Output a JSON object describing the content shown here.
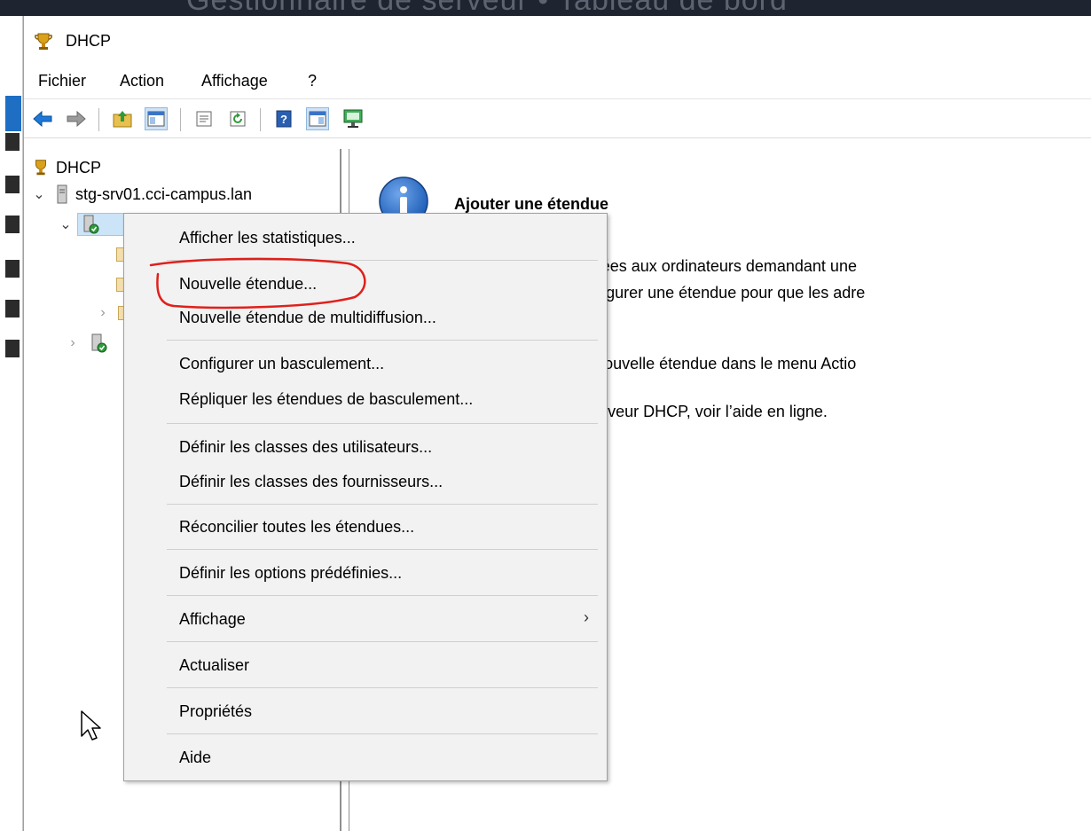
{
  "background": {
    "top_title": "Gestionnaire de serveur • Tableau de bord"
  },
  "window": {
    "title": "DHCP",
    "menu": [
      "Fichier",
      "Action",
      "Affichage",
      "?"
    ]
  },
  "toolbar": {
    "icons": [
      "back-arrow-icon",
      "forward-arrow-icon",
      "up-folder-icon",
      "show-hide-tree-icon",
      "properties-icon",
      "refresh-icon",
      "help-icon",
      "show-action-pane-icon",
      "monitor-icon"
    ]
  },
  "tree": {
    "root": "DHCP",
    "server": "stg-srv01.cci-campus.lan"
  },
  "details": {
    "heading": "Ajouter une étendue",
    "lines": [
      "d’adresses IP assignées aux ordinateurs demandant une",
      "s devez créer et configurer une étendue pour que les adre",
      "tendue, cliquez sur Nouvelle étendue dans le menu Actio",
      "r l’installation d’un serveur DHCP, voir l’aide en ligne."
    ]
  },
  "context_menu": {
    "items": [
      "Afficher les statistiques...",
      "Nouvelle étendue...",
      "Nouvelle étendue de multidiffusion...",
      "Configurer un basculement...",
      "Répliquer les étendues de basculement...",
      "Définir les classes des utilisateurs...",
      "Définir les classes des fournisseurs...",
      "Réconcilier toutes les étendues...",
      "Définir les options prédéfinies...",
      "Affichage",
      "Actualiser",
      "Propriétés",
      "Aide"
    ],
    "submenu_arrow": "›"
  },
  "colors": {
    "annotation": "#e0201b",
    "info_blue": "#1f5fb8",
    "menu_bg": "#f2f2f2"
  }
}
